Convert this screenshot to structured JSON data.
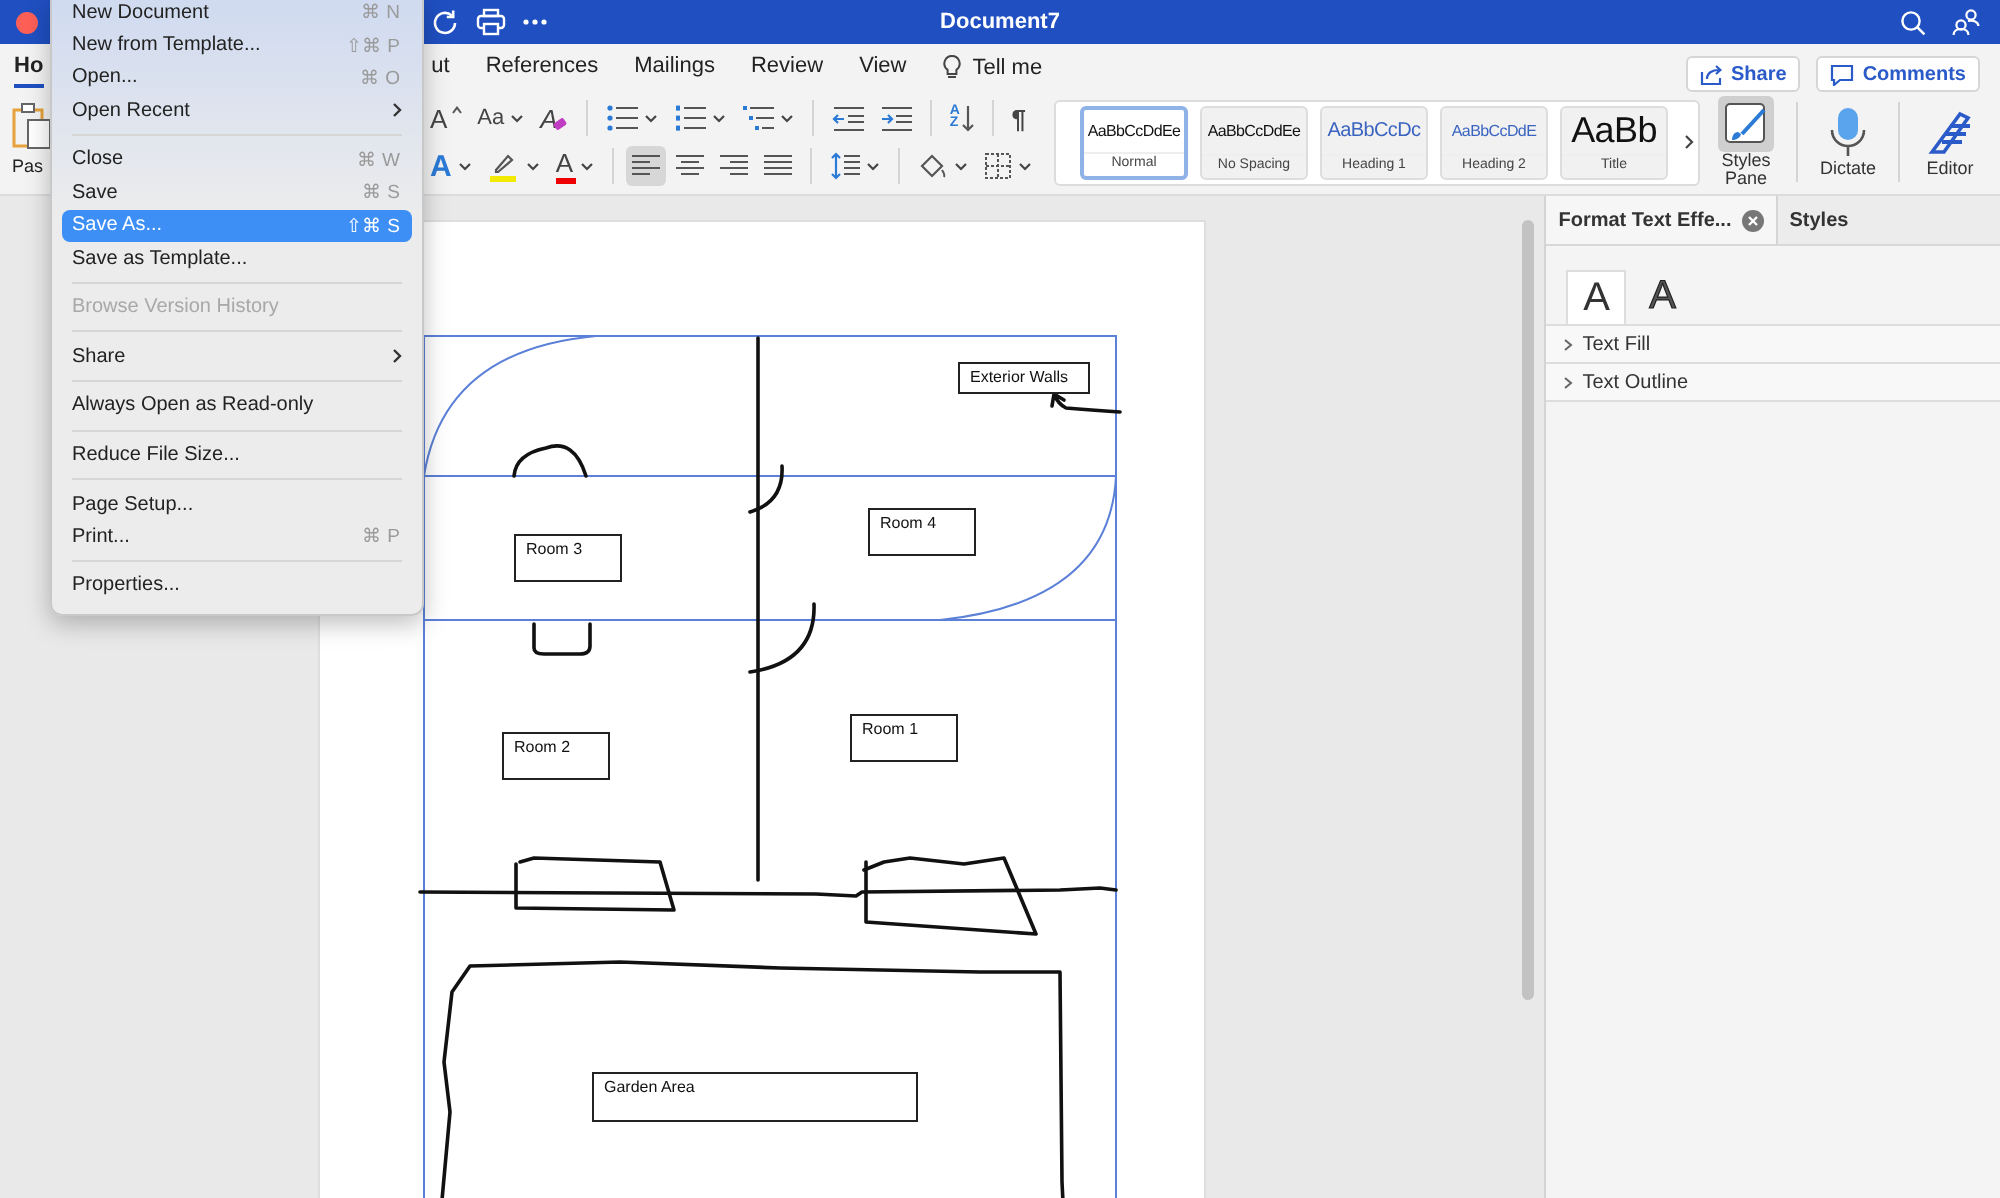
{
  "window": {
    "title": "Document7"
  },
  "tabs": [
    {
      "label": "Ho",
      "selected": true
    },
    {
      "label": "ut",
      "selected": false
    },
    {
      "label": "References",
      "selected": false
    },
    {
      "label": "Mailings",
      "selected": false
    },
    {
      "label": "Review",
      "selected": false
    },
    {
      "label": "View",
      "selected": false
    }
  ],
  "tell_me": {
    "label": "Tell me"
  },
  "header_buttons": [
    {
      "label": "Share",
      "kind": "share"
    },
    {
      "label": "Comments",
      "kind": "comments"
    }
  ],
  "ribbon": {
    "paste_label": "Pas",
    "row_1": [
      [
        {
          "kind": "grow_font",
          "glyph": "A",
          "dropdown": false
        },
        {
          "kind": "change_case",
          "glyph": "Aa",
          "dropdown": true
        },
        {
          "kind": "clear_format",
          "glyph": "A",
          "dropdown": false
        }
      ],
      [
        {
          "kind": "bullets",
          "dropdown": true
        },
        {
          "kind": "numbering",
          "dropdown": true
        },
        {
          "kind": "multilevel",
          "dropdown": true
        }
      ],
      [
        {
          "kind": "outdent",
          "dropdown": false
        },
        {
          "kind": "indent",
          "dropdown": false
        }
      ],
      [
        {
          "kind": "sort",
          "glyph": "AZ",
          "dropdown": false
        }
      ],
      [
        {
          "kind": "pilcrow",
          "glyph": "¶",
          "dropdown": false
        }
      ]
    ],
    "row_2": [
      [
        {
          "kind": "text_effects",
          "glyph": "A",
          "dropdown": true
        },
        {
          "kind": "highlight",
          "dropdown": true
        },
        {
          "kind": "font_color",
          "glyph": "A",
          "dropdown": true
        }
      ],
      [
        {
          "kind": "align_left",
          "dropdown": false,
          "selected": true
        },
        {
          "kind": "align_center",
          "dropdown": false,
          "selected": false
        },
        {
          "kind": "align_right",
          "dropdown": false,
          "selected": false
        },
        {
          "kind": "justify",
          "dropdown": false,
          "selected": false
        }
      ],
      [
        {
          "kind": "line_spacing",
          "dropdown": true
        }
      ],
      [
        {
          "kind": "shading",
          "dropdown": true
        },
        {
          "kind": "borders",
          "dropdown": true
        }
      ]
    ],
    "styles": [
      {
        "preview": "AaBbCcDdEe",
        "name": "Normal",
        "kind": "body",
        "selected": true
      },
      {
        "preview": "AaBbCcDdEe",
        "name": "No Spacing",
        "kind": "body",
        "selected": false
      },
      {
        "preview": "AaBbCcDc",
        "name": "Heading 1",
        "kind": "heading1",
        "selected": false
      },
      {
        "preview": "AaBbCcDdE",
        "name": "Heading 2",
        "kind": "heading2",
        "selected": false
      },
      {
        "preview": "AaBb",
        "name": "Title",
        "kind": "title",
        "selected": false
      }
    ],
    "buttons": [
      {
        "label": "Styles Pane",
        "kind": "styles_pane",
        "selected": true
      },
      {
        "label": "Dictate",
        "kind": "dictate",
        "selected": false
      },
      {
        "label": "Editor",
        "kind": "editor",
        "selected": false
      }
    ]
  },
  "document": {
    "text_boxes": [
      "Exterior Walls",
      "Room 4",
      "Room 3",
      "Room 1",
      "Room 2",
      "Garden Area"
    ]
  },
  "pane": {
    "tabs": [
      {
        "label": "Format Text Effe...",
        "selected": true,
        "closable": true
      },
      {
        "label": "Styles",
        "selected": false,
        "closable": false
      }
    ],
    "effect_tabs": [
      {
        "glyph": "A",
        "kind": "plain",
        "selected": true
      },
      {
        "glyph": "A",
        "kind": "outline",
        "selected": false
      }
    ],
    "sections": [
      {
        "label": "Text Fill",
        "expanded": false
      },
      {
        "label": "Text Outline",
        "expanded": false
      }
    ]
  },
  "menu": {
    "items": [
      {
        "kind": "item",
        "label": "New Document",
        "shortcut": "⌘ N",
        "submenu": false,
        "disabled": false,
        "selected": false
      },
      {
        "kind": "item",
        "label": "New from Template...",
        "shortcut": "⇧⌘ P",
        "submenu": false,
        "disabled": false,
        "selected": false
      },
      {
        "kind": "item",
        "label": "Open...",
        "shortcut": "⌘ O",
        "submenu": false,
        "disabled": false,
        "selected": false
      },
      {
        "kind": "item",
        "label": "Open Recent",
        "submenu": true,
        "disabled": false,
        "selected": false
      },
      {
        "kind": "separator"
      },
      {
        "kind": "item",
        "label": "Close",
        "shortcut": "⌘ W",
        "submenu": false,
        "disabled": false,
        "selected": false
      },
      {
        "kind": "item",
        "label": "Save",
        "shortcut": "⌘ S",
        "submenu": false,
        "disabled": false,
        "selected": false
      },
      {
        "kind": "item",
        "label": "Save As...",
        "shortcut": "⇧⌘ S",
        "submenu": false,
        "disabled": false,
        "selected": true
      },
      {
        "kind": "item",
        "label": "Save as Template...",
        "submenu": false,
        "disabled": false,
        "selected": false
      },
      {
        "kind": "separator"
      },
      {
        "kind": "item",
        "label": "Browse Version History",
        "submenu": false,
        "disabled": true,
        "selected": false
      },
      {
        "kind": "separator"
      },
      {
        "kind": "item",
        "label": "Share",
        "submenu": true,
        "disabled": false,
        "selected": false
      },
      {
        "kind": "separator"
      },
      {
        "kind": "item",
        "label": "Always Open as Read-only",
        "submenu": false,
        "disabled": false,
        "selected": false
      },
      {
        "kind": "separator"
      },
      {
        "kind": "item",
        "label": "Reduce File Size...",
        "submenu": false,
        "disabled": false,
        "selected": false
      },
      {
        "kind": "separator"
      },
      {
        "kind": "item",
        "label": "Page Setup...",
        "submenu": false,
        "disabled": false,
        "selected": false
      },
      {
        "kind": "item",
        "label": "Print...",
        "shortcut": "⌘ P",
        "submenu": false,
        "disabled": false,
        "selected": false
      },
      {
        "kind": "separator"
      },
      {
        "kind": "item",
        "label": "Properties...",
        "submenu": false,
        "disabled": false,
        "selected": false
      }
    ]
  }
}
